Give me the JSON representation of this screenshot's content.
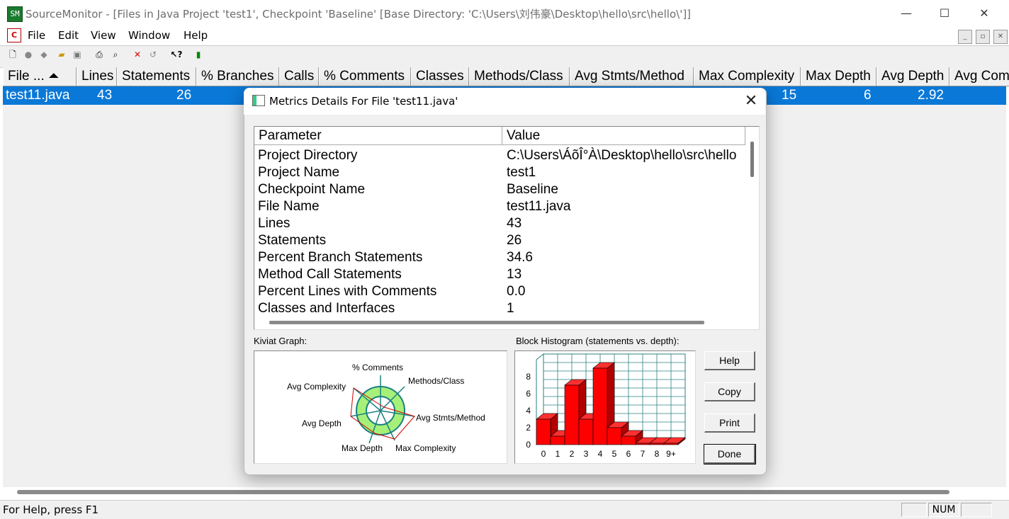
{
  "window": {
    "title": "SourceMonitor - [Files in Java Project 'test1', Checkpoint 'Baseline'  [Base Directory: 'C:\\Users\\刘伟豪\\Desktop\\hello\\src\\hello\\']]",
    "minimize": "—",
    "maximize": "☐",
    "close": "✕"
  },
  "menu": {
    "items": [
      "File",
      "Edit",
      "View",
      "Window",
      "Help"
    ],
    "mdi_minimize": "_",
    "mdi_restore": "▫",
    "mdi_close": "✕"
  },
  "toolbar": {
    "icons": [
      "new-file-icon",
      "record-icon",
      "stop-icon",
      "open-folder-icon",
      "save-icon",
      "print-icon",
      "print-preview-icon",
      "delete-icon",
      "refresh-icon",
      "help-pointer-icon",
      "export-icon"
    ]
  },
  "table": {
    "columns": [
      "File ... ⏶",
      "Lines",
      "Statements",
      "% Branches",
      "Calls",
      "% Comments",
      "Classes",
      "Methods/Class",
      "Avg Stmts/Method",
      "Max Complexity",
      "Max Depth",
      "Avg Depth",
      "Avg Com"
    ],
    "row": {
      "file": "test11.java",
      "lines": "43",
      "statements": "26",
      "max_complexity": "15",
      "max_depth": "6",
      "avg_depth": "2.92"
    }
  },
  "dialog": {
    "title": "Metrics Details For File 'test11.java'",
    "close": "✕",
    "list": {
      "col_parameter": "Parameter",
      "col_value": "Value",
      "rows": [
        {
          "param": "Project Directory",
          "value": "C:\\Users\\ÁõÎ°À\\Desktop\\hello\\src\\hello"
        },
        {
          "param": "Project Name",
          "value": "test1"
        },
        {
          "param": "Checkpoint Name",
          "value": "Baseline"
        },
        {
          "param": "File Name",
          "value": "test11.java"
        },
        {
          "param": "Lines",
          "value": "43"
        },
        {
          "param": "Statements",
          "value": "26"
        },
        {
          "param": "Percent Branch Statements",
          "value": "34.6"
        },
        {
          "param": "Method Call Statements",
          "value": "13"
        },
        {
          "param": "Percent Lines with Comments",
          "value": "0.0"
        },
        {
          "param": "Classes and Interfaces",
          "value": "1"
        }
      ]
    },
    "kiviat_label": "Kiviat Graph:",
    "kiviat_axes": [
      "% Comments",
      "Methods/Class",
      "Avg Stmts/Method",
      "Max Complexity",
      "Max Depth",
      "Avg Depth",
      "Avg Complexity"
    ],
    "histogram_label": "Block Histogram (statements vs. depth):",
    "histogram": {
      "categories": [
        "0",
        "1",
        "2",
        "3",
        "4",
        "5",
        "6",
        "7",
        "8",
        "9+"
      ],
      "values": [
        3,
        1,
        7,
        3,
        9,
        2,
        1,
        0,
        0,
        0
      ],
      "yticks": [
        "0",
        "2",
        "4",
        "6",
        "8"
      ],
      "bar_color": "#ff0000"
    },
    "buttons": {
      "help": "Help",
      "copy": "Copy",
      "print": "Print",
      "done": "Done"
    }
  },
  "statusbar": {
    "text": "For Help, press F1",
    "num": "NUM"
  }
}
